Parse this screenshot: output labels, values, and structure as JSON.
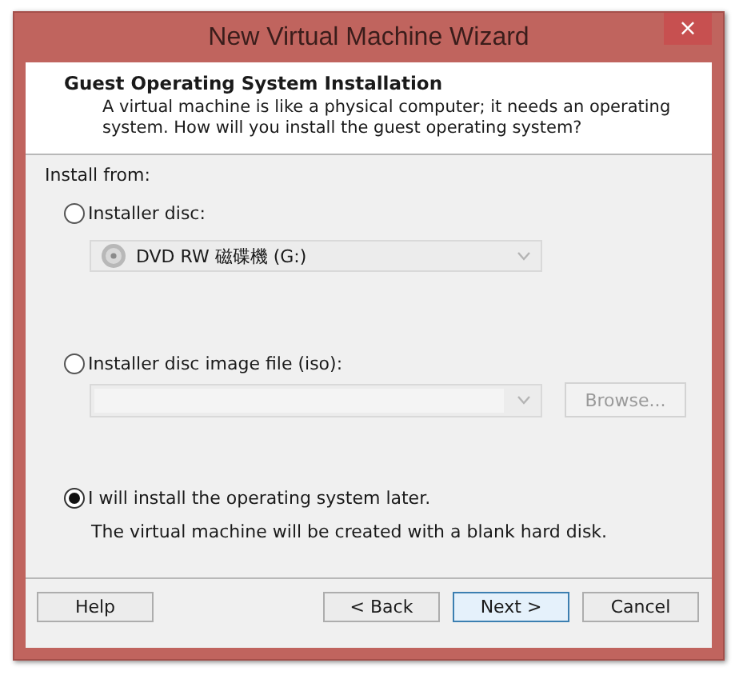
{
  "window": {
    "title": "New Virtual Machine Wizard",
    "close": "×"
  },
  "header": {
    "title": "Guest Operating System Installation",
    "description": "A virtual machine is like a physical computer; it needs an operating system. How will you install the guest operating system?"
  },
  "install_from": "Install from:",
  "options": [
    {
      "kind": "disc",
      "label": "Installer disc:",
      "selected": false,
      "drive": "DVD RW 磁碟機 (G:)",
      "disabled": true
    },
    {
      "kind": "iso",
      "label": "Installer disc image file (iso):",
      "selected": false,
      "browse": "Browse...",
      "disabled": true
    },
    {
      "kind": "later",
      "label": "I will install the operating system later.",
      "selected": true,
      "note": "The virtual machine will be created with a blank hard disk."
    }
  ],
  "buttons": [
    {
      "label": "Help",
      "default": false
    },
    {
      "label": "< Back",
      "default": false
    },
    {
      "label": "Next >",
      "default": true
    },
    {
      "label": "Cancel",
      "default": false
    }
  ]
}
